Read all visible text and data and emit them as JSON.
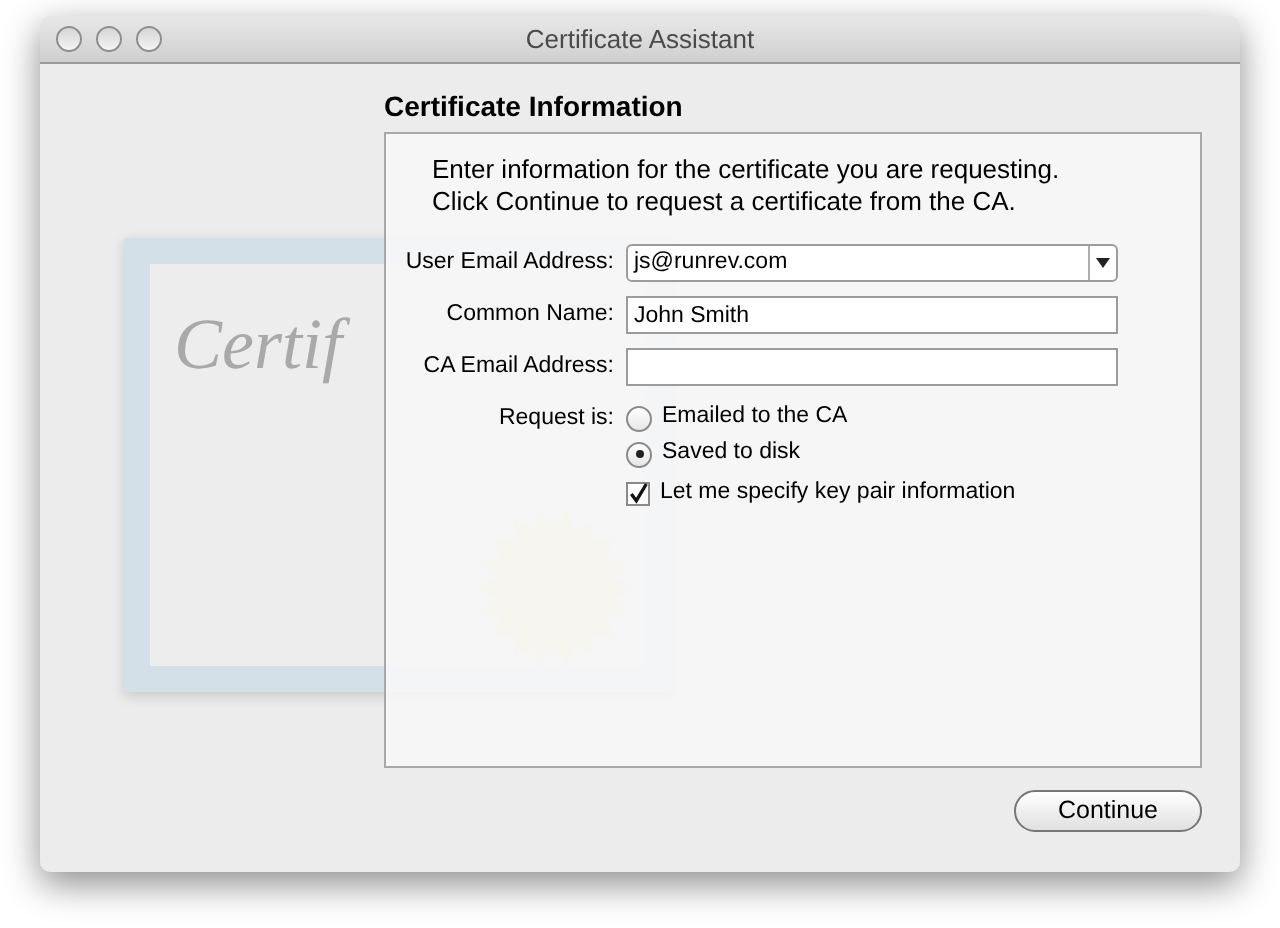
{
  "window": {
    "title": "Certificate Assistant"
  },
  "artwork": {
    "script_word": "Certif"
  },
  "heading": "Certificate Information",
  "intro": [
    "Enter information for the certificate you are requesting.",
    "Click Continue to request a certificate from the CA."
  ],
  "fields": [
    {
      "kind": "popup",
      "label": "User Email Address:",
      "value": "js@runrev.com"
    },
    {
      "kind": "text",
      "label": "Common Name:",
      "value": "John Smith"
    },
    {
      "kind": "text",
      "label": "CA Email Address:"
    }
  ],
  "request": {
    "label": "Request is:",
    "options": [
      {
        "label": "Emailed to the CA",
        "selected": false
      },
      {
        "label": "Saved to disk",
        "selected": true
      }
    ]
  },
  "key_pair": {
    "label": "Let me specify key pair information",
    "checked": true
  },
  "buttons": [
    {
      "label": "Continue"
    }
  ]
}
